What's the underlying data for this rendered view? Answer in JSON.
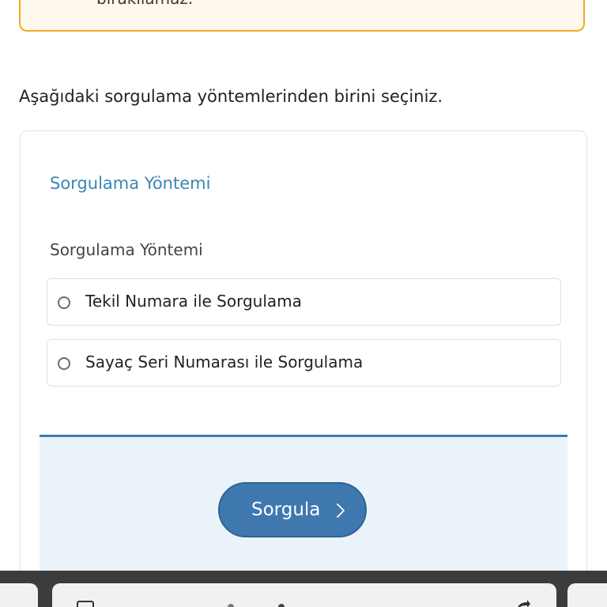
{
  "warning": {
    "text": "bırakılamaz.-"
  },
  "instruction": "Aşağıdaki sorgulama yöntemlerinden birini seçiniz.",
  "form": {
    "section_title": "Sorgulama Yöntemi",
    "field_label": "Sorgulama Yöntemi",
    "options": [
      {
        "label": "Tekil Numara ile Sorgulama",
        "selected": false
      },
      {
        "label": "Sayaç Seri Numarası ile Sorgulama",
        "selected": false
      }
    ],
    "submit_label": "Sorgula"
  },
  "colors": {
    "accent": "#3f78ae",
    "title": "#3d86b4",
    "warning_border": "#f2a920",
    "warning_bg": "#fff8ec",
    "panel_bg": "#ebf3fa"
  },
  "icons": {
    "submit": "chevron-right-icon",
    "radio": "radio-icon",
    "browser_tabs": "tabs-icon",
    "browser_share": "share-icon"
  }
}
